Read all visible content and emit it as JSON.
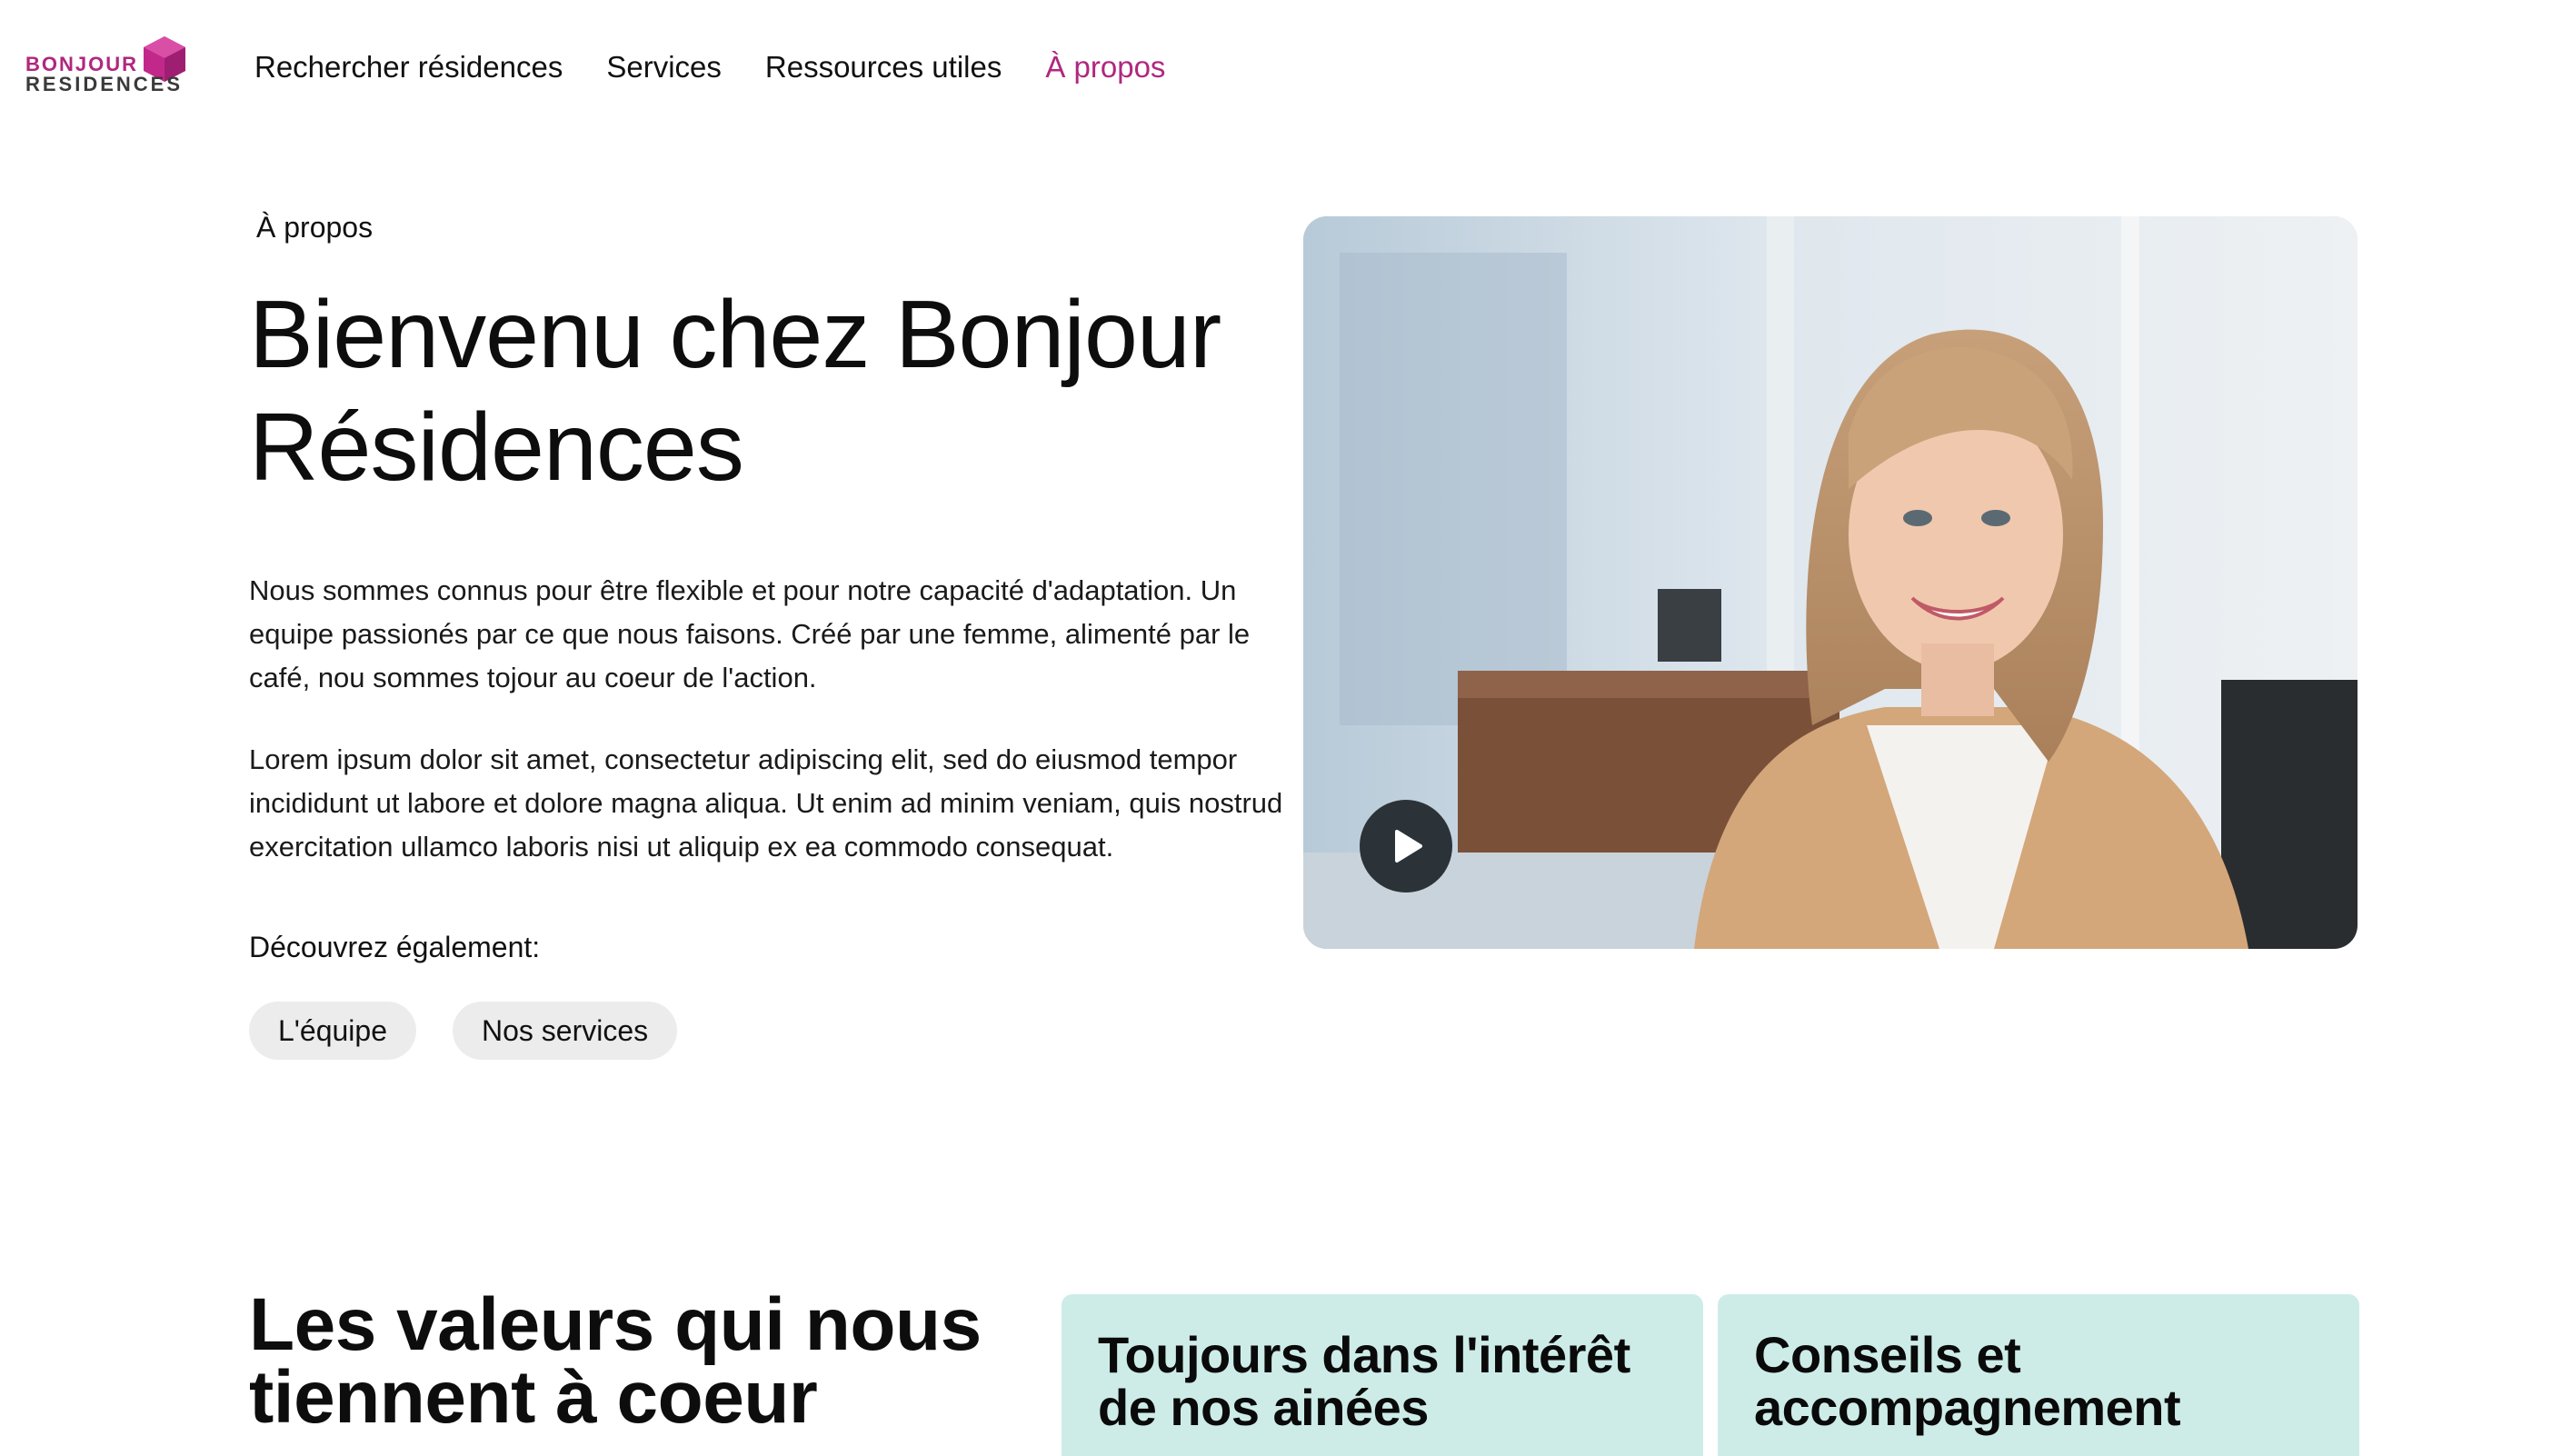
{
  "brand": {
    "logo_top": "BONJOUR",
    "logo_bottom": "RESIDENCES",
    "accent_color": "#b0277f"
  },
  "nav": {
    "items": [
      {
        "label": "Rechercher résidences",
        "active": false
      },
      {
        "label": "Services",
        "active": false
      },
      {
        "label": "Ressources utiles",
        "active": false
      },
      {
        "label": "À propos",
        "active": true
      }
    ]
  },
  "hero": {
    "eyebrow": "À propos",
    "title": "Bienvenu chez Bonjour Résidences",
    "paragraphs": [
      "Nous sommes connus pour être flexible et pour notre capacité d'adaptation. Un equipe passionés par ce que nous faisons. Créé par une femme, alimenté par le café, nou sommes tojour au coeur de l'action.",
      "Lorem ipsum dolor sit amet, consectetur adipiscing elit, sed do eiusmod tempor incididunt ut labore et dolore magna aliqua. Ut enim ad minim veniam, quis nostrud exercitation ullamco laboris nisi ut aliquip ex ea commodo consequat."
    ],
    "discover_label": "Découvrez également:",
    "chips": [
      "L'équipe",
      "Nos services"
    ]
  },
  "video": {
    "play_icon": "play-icon"
  },
  "values": {
    "title": "Les valeurs qui nous tiennent à coeur",
    "cards": [
      {
        "title": "Toujours dans l'intérêt de nos ainées"
      },
      {
        "title": "Conseils et accompagnement"
      }
    ],
    "card_color": "#cdece8"
  }
}
